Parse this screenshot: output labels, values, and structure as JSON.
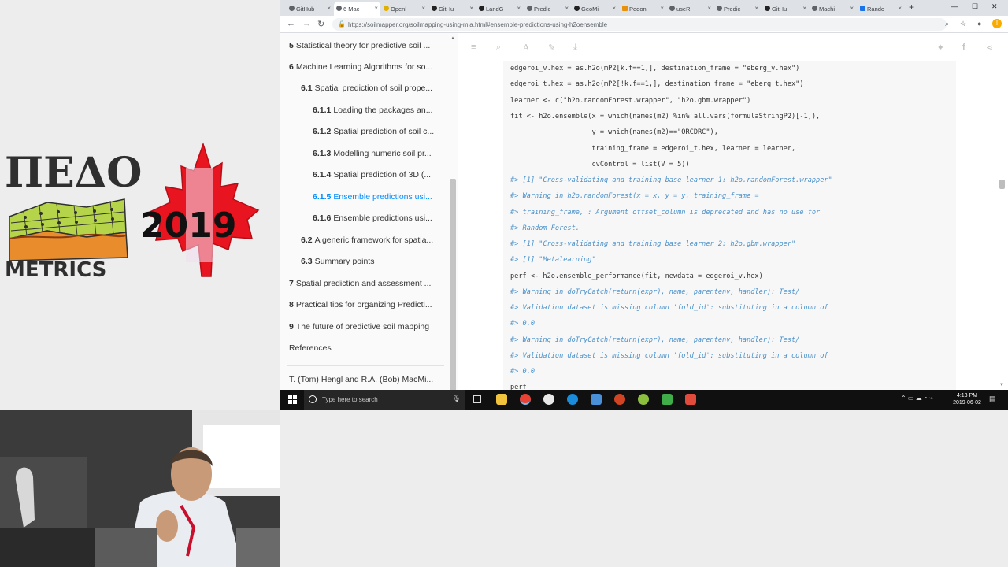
{
  "logo": {
    "title_letters": "ΠΕΔΟ",
    "subtitle": "METRICS",
    "year": "2019",
    "colors": {
      "maple_red": "#e8141f",
      "terrain_green": "#b5d44a",
      "terrain_orange": "#e98d2c",
      "text_dark": "#2f2f2f"
    }
  },
  "browser": {
    "tabs": [
      {
        "label": "GitHub"
      },
      {
        "label": "6 Mac"
      },
      {
        "label": "Openl"
      },
      {
        "label": "GitHu"
      },
      {
        "label": "LandG"
      },
      {
        "label": "Predic"
      },
      {
        "label": "GeoMi"
      },
      {
        "label": "Pedon"
      },
      {
        "label": "useRI"
      },
      {
        "label": "Predic"
      },
      {
        "label": "GitHu"
      },
      {
        "label": "Machi"
      },
      {
        "label": "Rando"
      }
    ],
    "url": "https://soilmapper.org/soilmapping-using-mla.html#ensemble-predictions-using-h2oensemble",
    "avatar_letter": "!"
  },
  "toc": {
    "items": [
      {
        "num": "5",
        "label": "Statistical theory for predictive soil ..."
      },
      {
        "num": "6",
        "label": "Machine Learning Algorithms for so..."
      },
      {
        "num": "6.1",
        "label": "Spatial prediction of soil prope..."
      },
      {
        "num": "6.1.1",
        "label": "Loading the packages an..."
      },
      {
        "num": "6.1.2",
        "label": "Spatial prediction of soil c..."
      },
      {
        "num": "6.1.3",
        "label": "Modelling numeric soil pr..."
      },
      {
        "num": "6.1.4",
        "label": "Spatial prediction of 3D (..."
      },
      {
        "num": "6.1.5",
        "label": "Ensemble predictions usi..."
      },
      {
        "num": "6.1.6",
        "label": "Ensemble predictions usi..."
      },
      {
        "num": "6.2",
        "label": "A generic framework for spatia..."
      },
      {
        "num": "6.3",
        "label": "Summary points"
      },
      {
        "num": "7",
        "label": "Spatial prediction and assessment ..."
      },
      {
        "num": "8",
        "label": "Practical tips for organizing Predicti..."
      },
      {
        "num": "9",
        "label": "The future of predictive soil mapping"
      },
      {
        "num": "",
        "label": "References"
      },
      {
        "num": "",
        "label": "T. (Tom) Hengl and R.A. (Bob) MacMi..."
      }
    ]
  },
  "code": {
    "lines": [
      {
        "text": "edgeroi_v.hex = as.h2o(mP2[k.f==1,], destination_frame = \"eberg_v.hex\")",
        "comment": false
      },
      {
        "text": "edgeroi_t.hex = as.h2o(mP2[!k.f==1,], destination_frame = \"eberg_t.hex\")",
        "comment": false
      },
      {
        "text": "learner <- c(\"h2o.randomForest.wrapper\", \"h2o.gbm.wrapper\")",
        "comment": false
      },
      {
        "text": "fit <- h2o.ensemble(x = which(names(m2) %in% all.vars(formulaStringP2)[-1]),",
        "comment": false
      },
      {
        "text": "                    y = which(names(m2)==\"ORCDRC\"),",
        "comment": false
      },
      {
        "text": "                    training_frame = edgeroi_t.hex, learner = learner,",
        "comment": false
      },
      {
        "text": "                    cvControl = list(V = 5))",
        "comment": false
      },
      {
        "text": "#> [1] \"Cross-validating and training base learner 1: h2o.randomForest.wrapper\"",
        "comment": true
      },
      {
        "text": "#> Warning in h2o.randomForest(x = x, y = y, training_frame =",
        "comment": true
      },
      {
        "text": "#> training_frame, : Argument offset_column is deprecated and has no use for",
        "comment": true
      },
      {
        "text": "#> Random Forest.",
        "comment": true
      },
      {
        "text": "#> [1] \"Cross-validating and training base learner 2: h2o.gbm.wrapper\"",
        "comment": true
      },
      {
        "text": "#> [1] \"Metalearning\"",
        "comment": true
      },
      {
        "text": "perf <- h2o.ensemble_performance(fit, newdata = edgeroi_v.hex)",
        "comment": false
      },
      {
        "text": "#> Warning in doTryCatch(return(expr), name, parentenv, handler): Test/",
        "comment": true
      },
      {
        "text": "#> Validation dataset is missing column 'fold_id': substituting in a column of",
        "comment": true
      },
      {
        "text": "#> 0.0",
        "comment": true
      },
      {
        "text": "#> Warning in doTryCatch(return(expr), name, parentenv, handler): Test/",
        "comment": true
      },
      {
        "text": "#> Validation dataset is missing column 'fold_id': substituting in a column of",
        "comment": true
      },
      {
        "text": "#> 0.0",
        "comment": true
      },
      {
        "text": "perf",
        "comment": false
      }
    ]
  },
  "taskbar": {
    "search_placeholder": "Type here to search",
    "time": "4:13 PM",
    "date": "2019-06-02"
  }
}
